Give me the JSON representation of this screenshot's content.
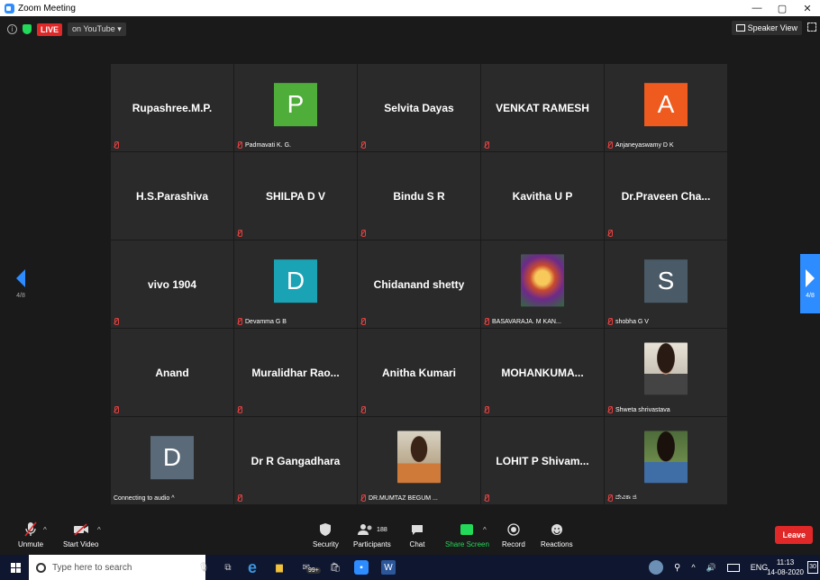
{
  "window": {
    "title": "Zoom Meeting",
    "min": "—",
    "max": "▢",
    "close": "✕"
  },
  "topbar": {
    "live": "LIVE",
    "stream_label": "on YouTube ▾",
    "speaker_view": "Speaker View"
  },
  "pager": {
    "left": "4/8",
    "right": "4/8"
  },
  "participants": [
    {
      "type": "name",
      "name": "Rupashree.M.P.",
      "label": ""
    },
    {
      "type": "avatar",
      "letter": "P",
      "color": "#4fae3a",
      "label": "Padmavati K. G."
    },
    {
      "type": "name",
      "name": "Selvita Dayas",
      "label": ""
    },
    {
      "type": "name",
      "name": "VENKAT RAMESH",
      "label": ""
    },
    {
      "type": "avatar",
      "letter": "A",
      "color": "#ef5a1e",
      "label": "Anjaneyaswamy D K"
    },
    {
      "type": "name",
      "name": "H.S.Parashiva",
      "label": "",
      "nomic": true
    },
    {
      "type": "name",
      "name": "SHILPA D V",
      "label": ""
    },
    {
      "type": "name",
      "name": "Bindu S R",
      "label": ""
    },
    {
      "type": "name",
      "name": "Kavitha U P",
      "label": "",
      "nomic": true
    },
    {
      "type": "name",
      "name": "Dr.Praveen Cha...",
      "label": ""
    },
    {
      "type": "name",
      "name": "vivo 1904",
      "label": ""
    },
    {
      "type": "avatar",
      "letter": "D",
      "color": "#1aa3b5",
      "label": "Devamma G B"
    },
    {
      "type": "name",
      "name": "Chidanand shetty",
      "label": ""
    },
    {
      "type": "photo",
      "photo": "deity",
      "label": "BASAVARAJA. M KAN..."
    },
    {
      "type": "avatar",
      "letter": "S",
      "color": "#4a5a66",
      "label": "shobha G V"
    },
    {
      "type": "name",
      "name": "Anand",
      "label": ""
    },
    {
      "type": "name",
      "name": "Muralidhar Rao...",
      "label": ""
    },
    {
      "type": "name",
      "name": "Anitha Kumari",
      "label": ""
    },
    {
      "type": "name",
      "name": "MOHANKUMA...",
      "label": ""
    },
    {
      "type": "photo",
      "photo": "woman",
      "label": "Shweta shrivastava"
    },
    {
      "type": "avatar",
      "letter": "D",
      "color": "#5a6a78",
      "label": "Connecting to audio ^",
      "nomic": true
    },
    {
      "type": "name",
      "name": "Dr R Gangadhara",
      "label": ""
    },
    {
      "type": "photo",
      "photo": "woman2",
      "label": "DR.MUMTAZ BEGUM ..."
    },
    {
      "type": "name",
      "name": "LOHIT P Shivam...",
      "label": ""
    },
    {
      "type": "photo",
      "photo": "woman3",
      "label": "ದೇವಿಕಾ ಜಿ"
    }
  ],
  "toolbar": {
    "unmute": "Unmute",
    "start_video": "Start Video",
    "security": "Security",
    "participants": "Participants",
    "participants_count": "188",
    "chat": "Chat",
    "share_screen": "Share Screen",
    "record": "Record",
    "reactions": "Reactions",
    "leave": "Leave"
  },
  "taskbar": {
    "search_placeholder": "Type here to search",
    "badge": "99+",
    "lang": "ENG",
    "time": "11:13",
    "date": "14-08-2020",
    "notif": "30"
  }
}
